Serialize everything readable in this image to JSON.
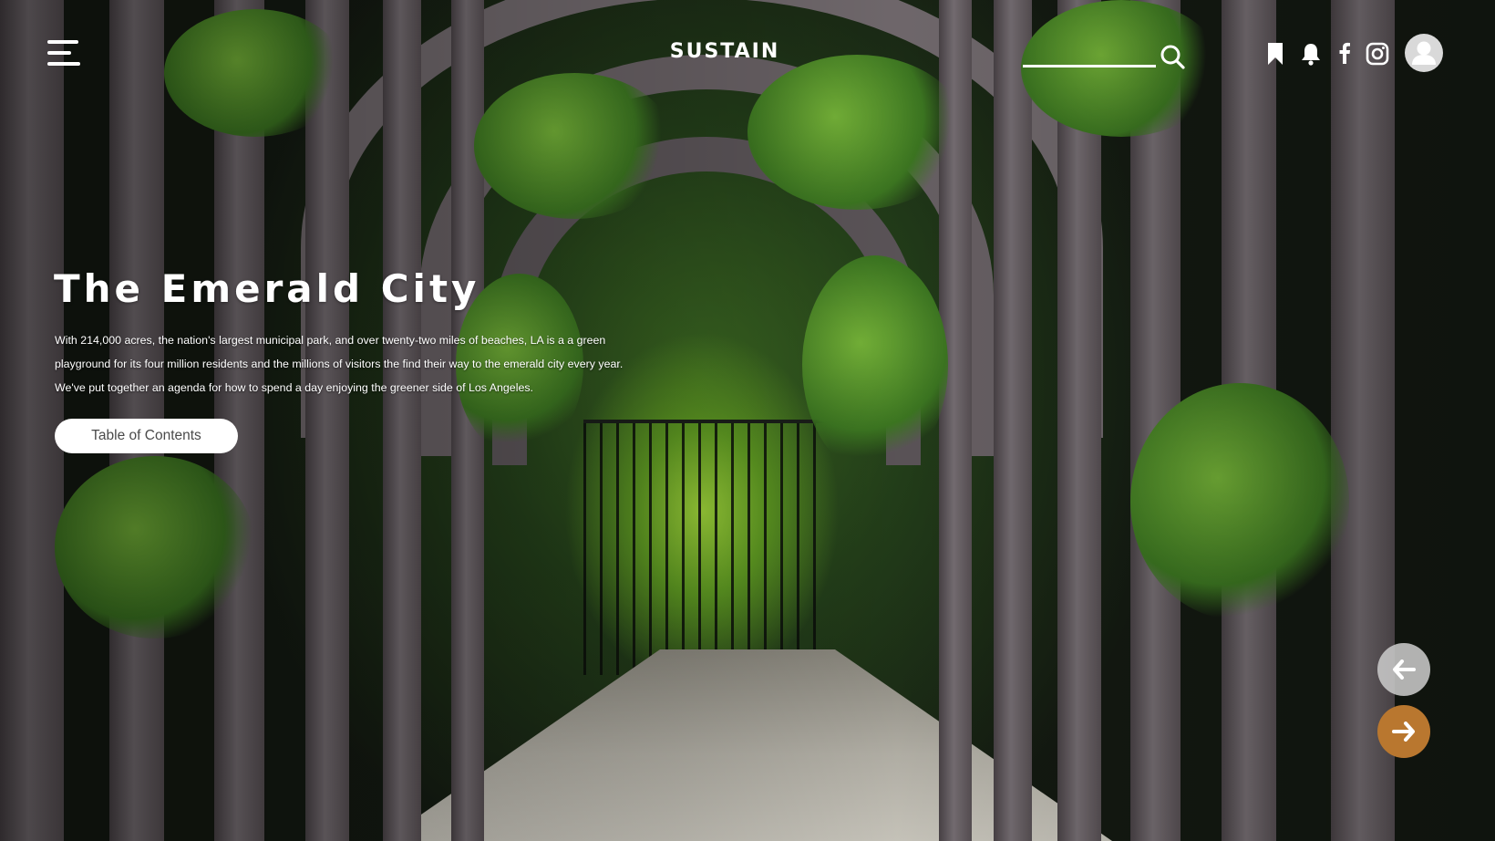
{
  "header": {
    "brand": "SUSTAIN",
    "search": {
      "placeholder": "",
      "value": ""
    },
    "icons": [
      "menu-icon",
      "search-icon",
      "bookmark-icon",
      "bell-icon",
      "facebook-icon",
      "instagram-icon",
      "user-icon"
    ]
  },
  "hero": {
    "title": "The Emerald City",
    "description_lines": [
      "With 214,000 acres, the nation's largest municipal park, and over twenty-two miles of beaches, LA is a a green",
      "playground for its four million residents and the millions of visitors the find their way to the emerald city every year.",
      "We've put together an agenda for how to spend a day enjoying the greener side of Los Angeles."
    ],
    "cta_label": "Table of Contents"
  },
  "navigation": {
    "prev_icon": "arrow-left-icon",
    "next_icon": "arrow-right-icon"
  },
  "colors": {
    "next_button": "#b9772f",
    "prev_button": "#c8c8c8",
    "cta_background": "#ffffff",
    "cta_text": "#4a4a4a"
  }
}
